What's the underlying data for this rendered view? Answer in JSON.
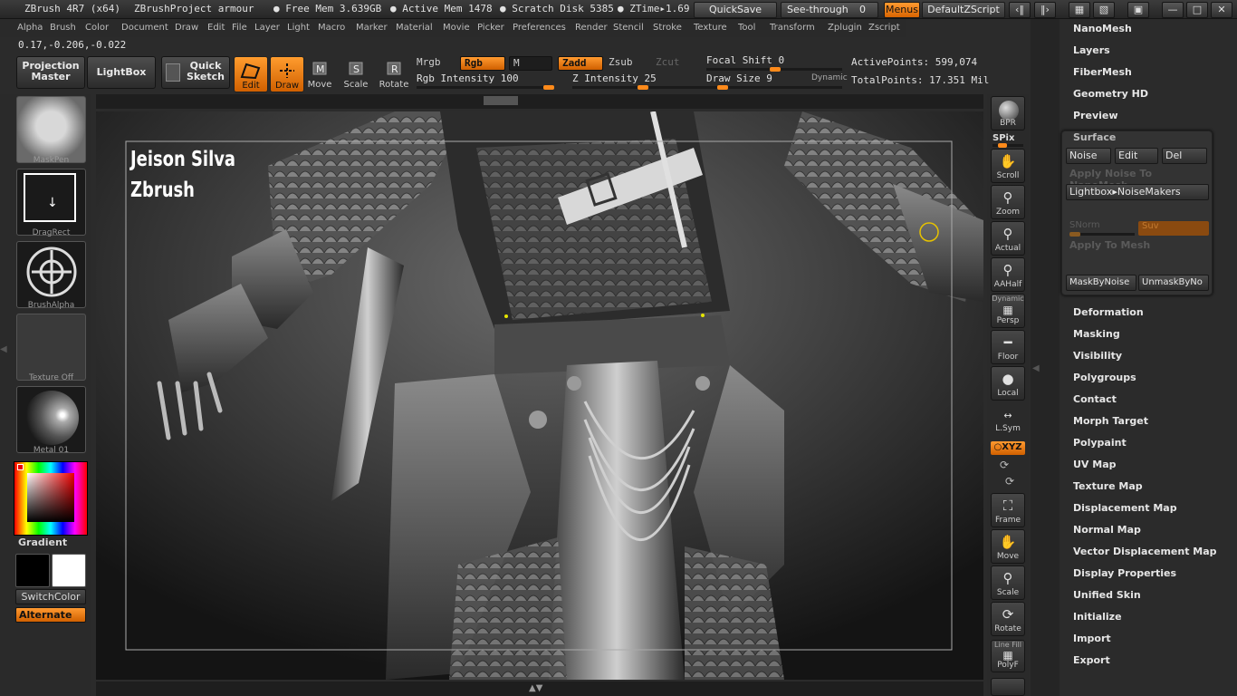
{
  "title_bar": {
    "app": "ZBrush 4R7 (x64)",
    "project": "ZBrushProject armour",
    "free_mem": "● Free Mem 3.639GB",
    "active_mem": "● Active Mem 1478",
    "scratch": "● Scratch Disk 5385",
    "ztime": "● ZTime▸1.69",
    "quicksave": "QuickSave",
    "see_through": "See-through",
    "see_through_value": "0",
    "menus": "Menus",
    "default_zscript": "DefaultZScript"
  },
  "menu": [
    "Alpha",
    "Brush",
    "Color",
    "Document",
    "Draw",
    "Edit",
    "File",
    "Layer",
    "Light",
    "Macro",
    "Marker",
    "Material",
    "Movie",
    "Picker",
    "Preferences",
    "Render",
    "Stencil",
    "Stroke",
    "Texture",
    "Tool",
    "Transform",
    "Zplugin",
    "Zscript"
  ],
  "coords": "0.17,-0.206,-0.022",
  "toolbar": {
    "projection_master": "Projection Master",
    "lightbox": "LightBox",
    "quick_sketch": "Quick Sketch",
    "edit": "Edit",
    "draw": "Draw",
    "move": "Move",
    "scale": "Scale",
    "rotate": "Rotate",
    "mrgb": "Mrgb",
    "rgb": "Rgb",
    "m": "M",
    "zadd": "Zadd",
    "zsub": "Zsub",
    "zcut": "Zcut",
    "rgb_intensity": "Rgb Intensity 100",
    "z_intensity": "Z Intensity 25",
    "focal_shift": "Focal Shift 0",
    "draw_size": "Draw Size 9",
    "dynamic": "Dynamic",
    "active_points": "ActivePoints: 599,074",
    "total_points": "TotalPoints: 17.351 Mil"
  },
  "left_panel": {
    "brush": "MaskPen",
    "stroke": "DragRect",
    "alpha": "BrushAlpha",
    "texture": "Texture Off",
    "material": "Metal 01",
    "gradient": "Gradient",
    "switch_color": "SwitchColor",
    "alternate": "Alternate"
  },
  "viewport": {
    "overlay_line1": "Jeison Silva",
    "overlay_line2": "Zbrush"
  },
  "shelf": {
    "bpr": "BPR",
    "spix": "SPix",
    "scroll": "Scroll",
    "zoom": "Zoom",
    "actual": "Actual",
    "aahalf": "AAHalf",
    "dynamic": "Dynamic",
    "persp": "Persp",
    "floor": "Floor",
    "local": "Local",
    "lsym": "L.Sym",
    "xyz": "○XYZ",
    "frame": "Frame",
    "move": "Move",
    "scale": "Scale",
    "rotate": "Rotate",
    "linefill": "Line Fill",
    "polyf": "PolyF"
  },
  "palette": {
    "items_top": [
      "NanoMesh",
      "Layers",
      "FiberMesh",
      "Geometry HD",
      "Preview"
    ],
    "surface": {
      "title": "Surface",
      "noise": "Noise",
      "edit": "Edit",
      "del": "Del",
      "apply_noise": "Apply Noise To NanoMesh",
      "lightbox_noisemakers": "Lightbox▸NoiseMakers",
      "snorm": "SNorm",
      "suv": "Suv",
      "apply_to_mesh": "Apply To Mesh",
      "mask_by_noise": "MaskByNoise",
      "unmask_by_noise": "UnmaskByNo"
    },
    "items_bottom": [
      "Deformation",
      "Masking",
      "Visibility",
      "Polygroups",
      "Contact",
      "Morph Target",
      "Polypaint",
      "UV Map",
      "Texture Map",
      "Displacement Map",
      "Normal Map",
      "Vector Displacement Map",
      "Display Properties",
      "Unified Skin",
      "Initialize",
      "Import",
      "Export"
    ]
  },
  "colors": {
    "accent": "#f08020",
    "background": "#2b2b2b",
    "viewport": "#0c0c0c"
  }
}
